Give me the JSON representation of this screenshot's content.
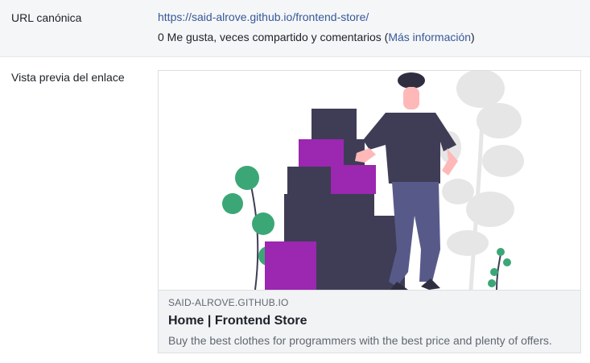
{
  "canonical": {
    "label": "URL canónica",
    "url": "https://said-alrove.github.io/frontend-store/",
    "stats_text": "0 Me gusta, veces compartido y comentarios (",
    "more_info": "Más información",
    "stats_close": ")"
  },
  "preview": {
    "label": "Vista previa del enlace",
    "image": "illustration of a person leaning on stacked boxes with plants",
    "domain": "SAID-ALROVE.GITHUB.IO",
    "title": "Home | Frontend Store",
    "description": "Buy the best clothes for programmers with the best price and plenty of offers."
  },
  "colors": {
    "link": "#365899",
    "box_dark": "#3f3d56",
    "box_purple": "#9c27b0",
    "plant_green": "#3ba776"
  }
}
